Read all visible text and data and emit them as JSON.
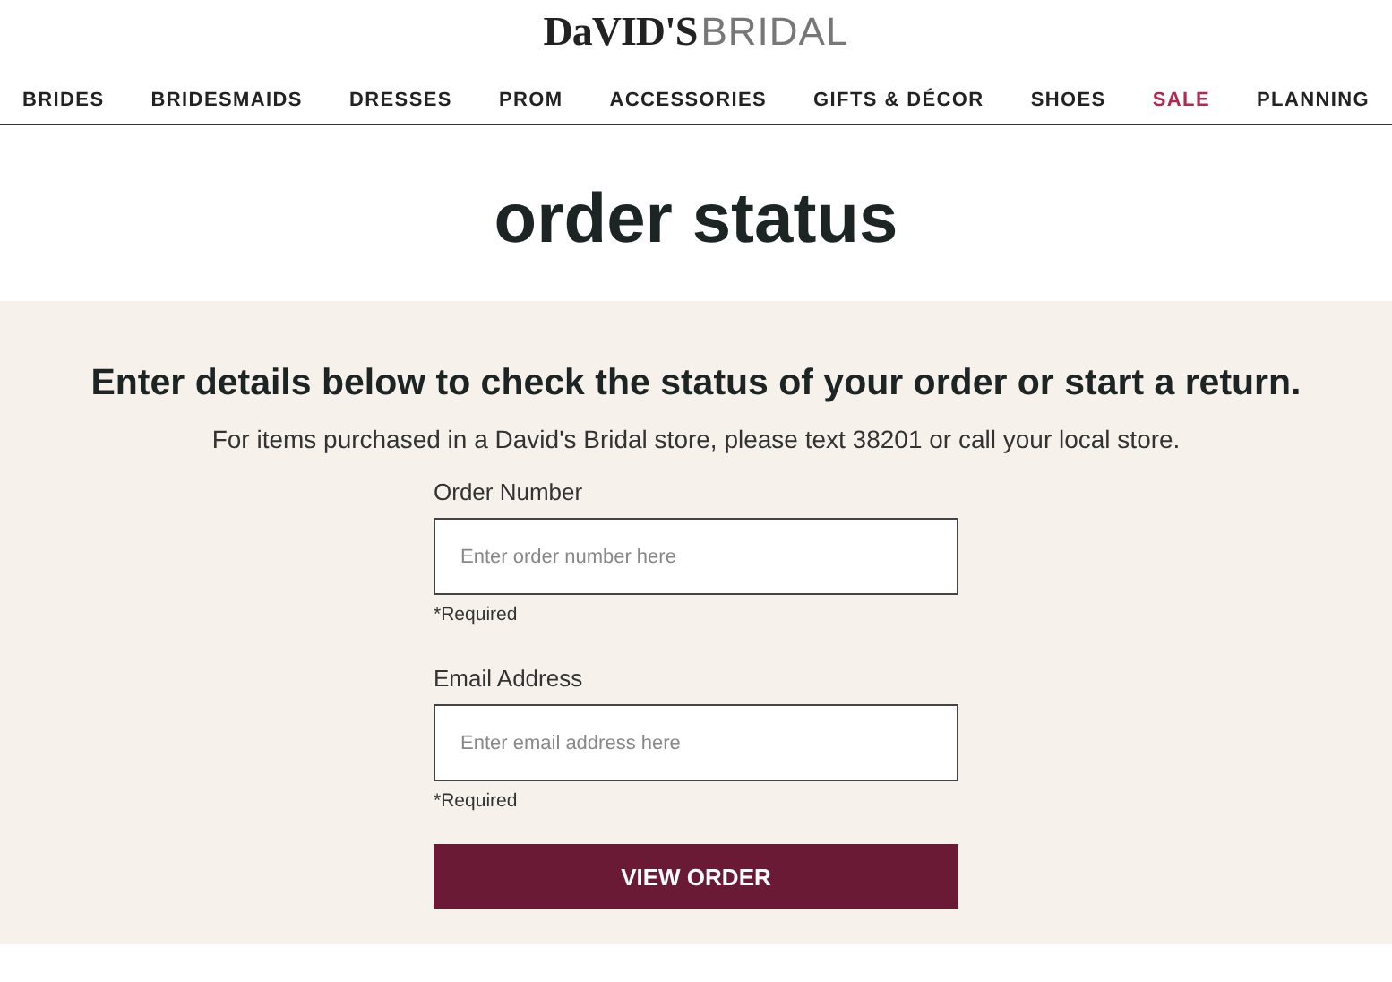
{
  "logo": {
    "brand": "DaVID'S",
    "suffix": "BRIDAL"
  },
  "nav": [
    {
      "label": "BRIDES",
      "color": "#222222"
    },
    {
      "label": "BRIDESMAIDS",
      "color": "#222222"
    },
    {
      "label": "DRESSES",
      "color": "#222222"
    },
    {
      "label": "PROM",
      "color": "#222222"
    },
    {
      "label": "ACCESSORIES",
      "color": "#222222"
    },
    {
      "label": "GIFTS & DÉCOR",
      "color": "#222222"
    },
    {
      "label": "SHOES",
      "color": "#222222"
    },
    {
      "label": "SALE",
      "color": "#b0294f"
    },
    {
      "label": "PLANNING",
      "color": "#222222"
    }
  ],
  "page_title": "order status",
  "form": {
    "heading": "Enter details below to check the status of your order or start a return.",
    "note": "For items purchased in a David's Bridal store, please text 38201 or call your local store.",
    "fields": [
      {
        "label": "Order Number",
        "placeholder": "Enter order number here",
        "hint": "*Required"
      },
      {
        "label": "Email Address",
        "placeholder": "Enter email address here",
        "hint": "*Required"
      }
    ],
    "button": "VIEW ORDER"
  }
}
